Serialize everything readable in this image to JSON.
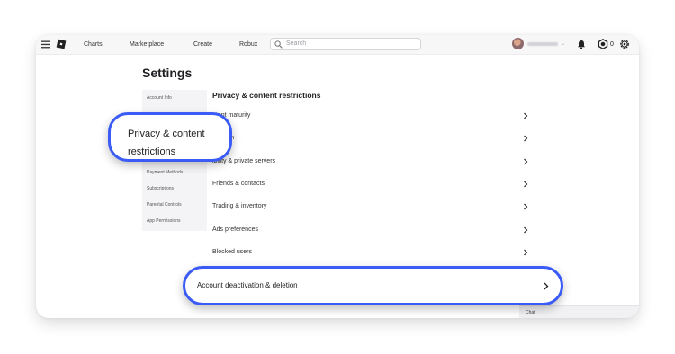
{
  "topbar": {
    "nav": [
      "Charts",
      "Marketplace",
      "Create",
      "Robux"
    ],
    "search_placeholder": "Search",
    "robux_count": "0",
    "icons": [
      "menu-icon",
      "roblox-logo",
      "search-icon",
      "avatar",
      "bell-icon",
      "robux-icon",
      "gear-icon"
    ]
  },
  "page": {
    "title": "Settings"
  },
  "sidenav": {
    "items": [
      "Account Info",
      "Privacy & content restrictions",
      "Payment Methods",
      "Subscriptions",
      "Parental Controls",
      "App Permissions"
    ]
  },
  "content": {
    "section_title": "Privacy & content restrictions",
    "rows": [
      "Content maturity",
      "Communication",
      "Visibility & private servers",
      "Friends & contacts",
      "Trading & inventory",
      "Ads preferences",
      "Blocked users"
    ],
    "visible_rows": [
      "ntent maturity",
      "nication",
      "ibility & private servers",
      "Friends & contacts",
      "Trading & inventory",
      "Ads preferences",
      "Blocked users"
    ]
  },
  "callouts": {
    "privacy": "Privacy & content restrictions",
    "deactivation": "Account deactivation & deletion"
  },
  "chat_label": "Chat",
  "colors": {
    "highlight": "#3b5bf6",
    "topbar": "#f7f7f8",
    "sidenav": "#f4f4f6"
  }
}
